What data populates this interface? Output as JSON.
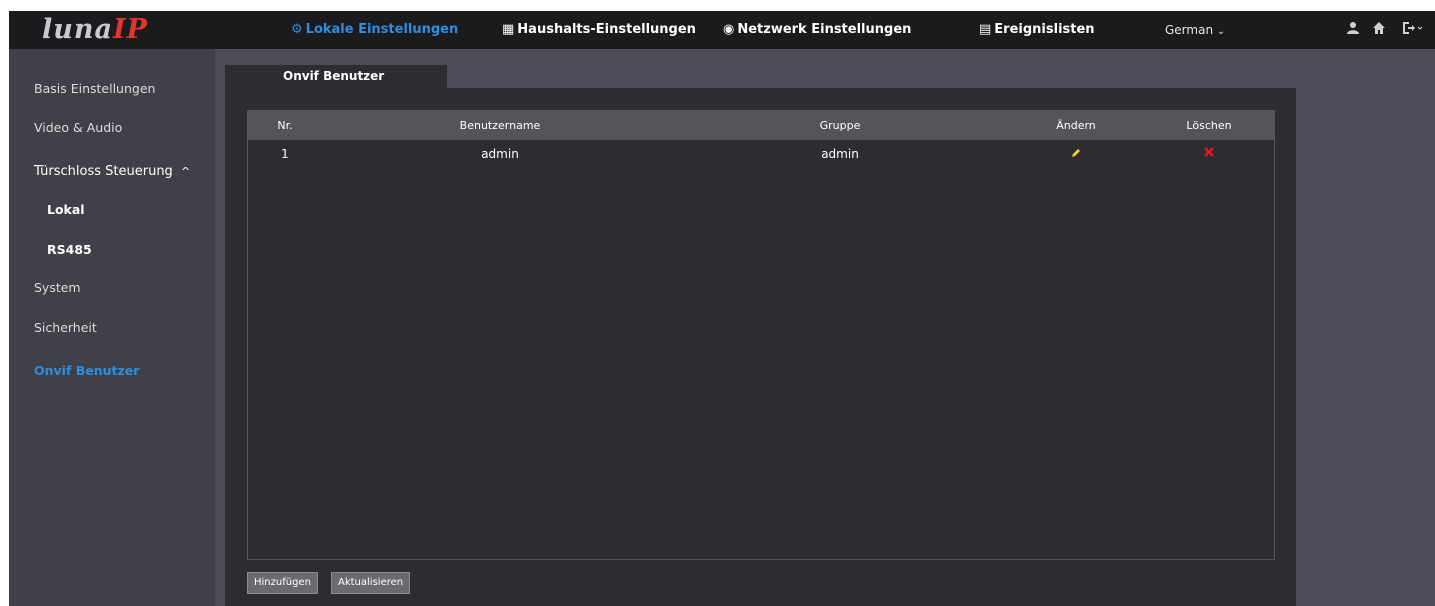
{
  "brand": {
    "logo_part1": "luna",
    "logo_part2": "IP"
  },
  "nav": {
    "items": [
      {
        "label": "Lokale Einstellungen",
        "icon": "gear-icon",
        "glyph": "⚙",
        "active": true
      },
      {
        "label": "Haushalts-Einstellungen",
        "icon": "building-icon",
        "glyph": "▦",
        "active": false
      },
      {
        "label": "Netzwerk Einstellungen",
        "icon": "globe-icon",
        "glyph": "◉",
        "active": false
      },
      {
        "label": "Ereignislisten",
        "icon": "list-icon",
        "glyph": "▤",
        "active": false
      }
    ],
    "language": "German",
    "language_caret": "⌄"
  },
  "sidebar": {
    "items": [
      {
        "label": "Basis Einstellungen"
      },
      {
        "label": "Video & Audio"
      },
      {
        "label": "Türschloss Steuerung"
      },
      {
        "label": "Lokal"
      },
      {
        "label": "RS485"
      },
      {
        "label": "System"
      },
      {
        "label": "Sicherheit"
      },
      {
        "label": "Onvif Benutzer"
      }
    ]
  },
  "main": {
    "tab_label": "Onvif Benutzer",
    "table": {
      "columns": [
        "Nr.",
        "Benutzername",
        "Gruppe",
        "Ändern",
        "Löschen"
      ],
      "rows": [
        {
          "nr": "1",
          "username": "admin",
          "group": "admin"
        }
      ]
    },
    "buttons": {
      "add": "Hinzufügen",
      "refresh": "Aktualisieren"
    }
  },
  "colors": {
    "accent": "#2d8ee0",
    "topbar": "#1b1b1e",
    "sidebar": "#404049",
    "panel": "#2c2c31",
    "edit": "#f3d21c",
    "delete": "#e21c1c"
  }
}
